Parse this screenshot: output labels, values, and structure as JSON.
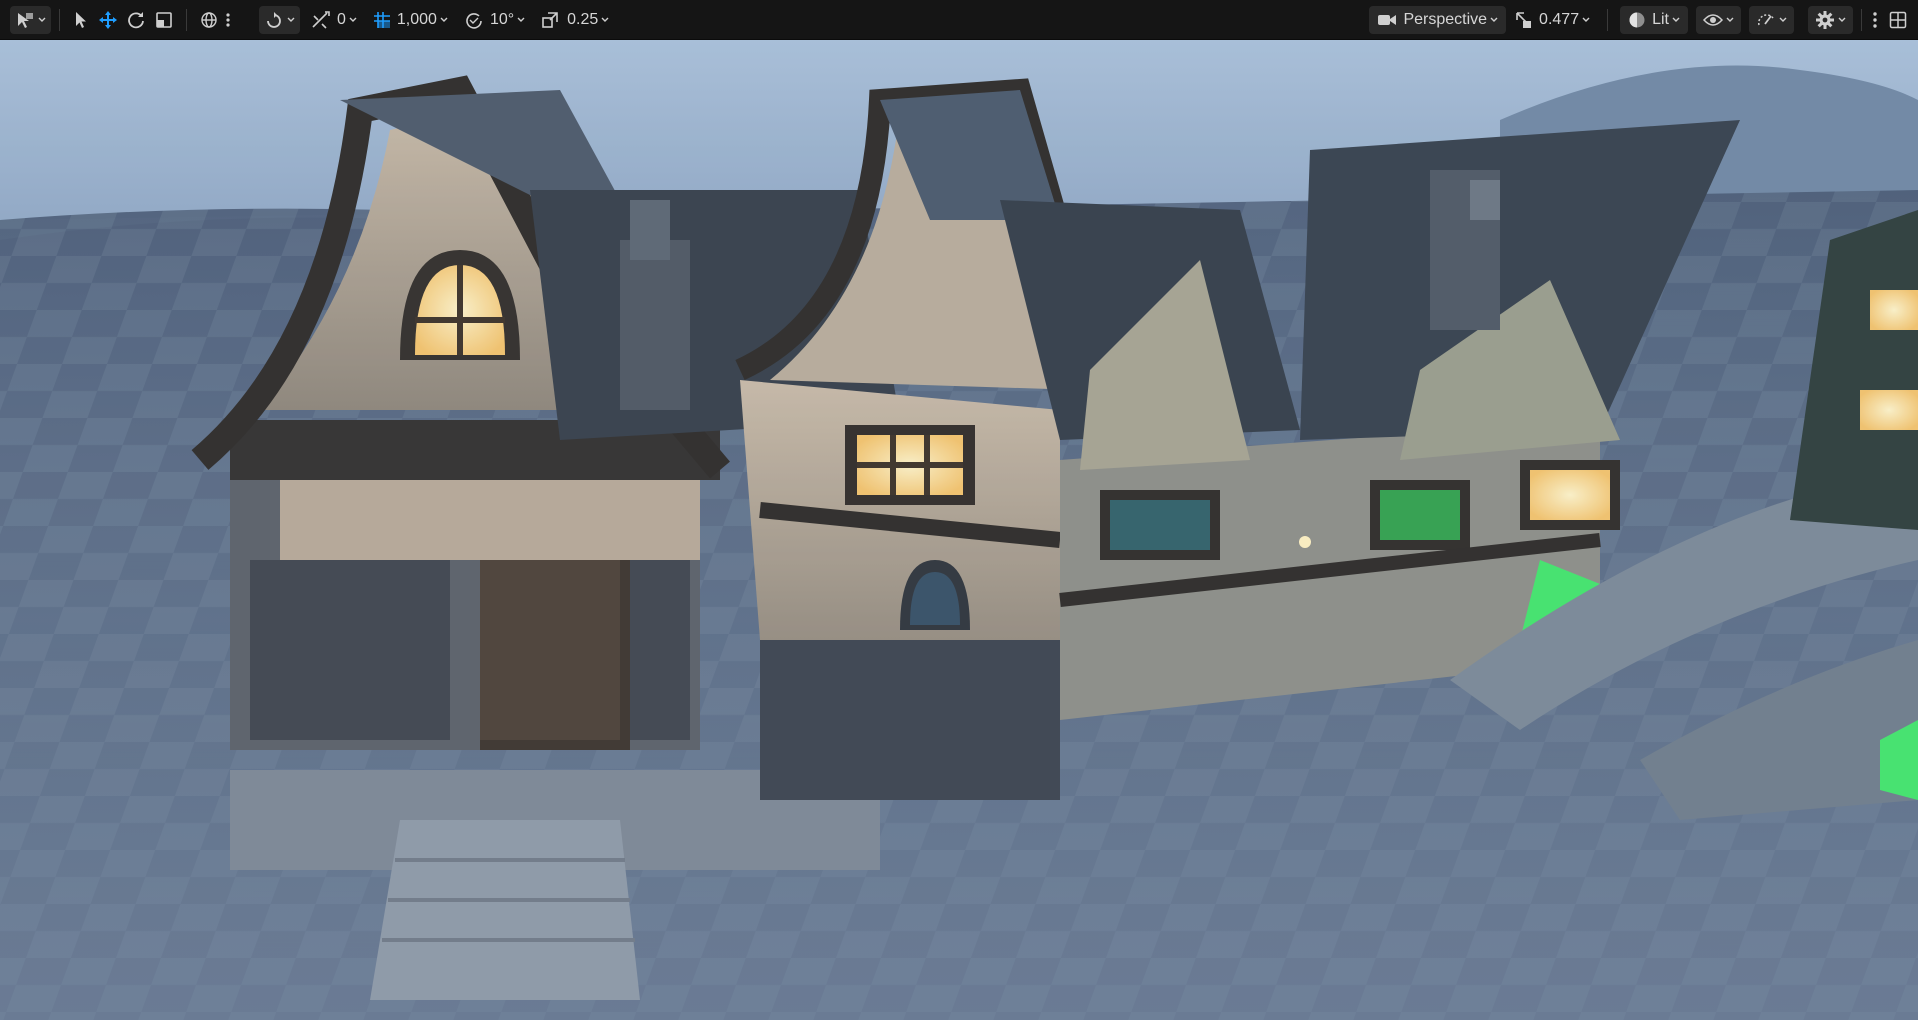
{
  "toolbar": {
    "translate_snap_value": "0",
    "grid_size_value": "1,000",
    "rotation_snap_value": "10°",
    "scale_snap_value": "0.25",
    "view_mode_label": "Perspective",
    "camera_speed_value": "0.477",
    "lighting_mode_label": "Lit",
    "accent_color": "#1f9eff"
  },
  "icons": [
    "select-mode-icon",
    "select-arrow-icon",
    "translate-icon",
    "rotate-icon",
    "scale-icon",
    "world-space-icon",
    "more-vert-icon",
    "surface-snap-icon",
    "translate-snap-icon",
    "grid-icon",
    "rotation-snap-icon",
    "scale-snap-icon",
    "camera-icon",
    "camera-speed-icon",
    "lit-sphere-icon",
    "eye-icon",
    "realtime-icon",
    "settings-gear-icon",
    "layout-grid-icon"
  ]
}
